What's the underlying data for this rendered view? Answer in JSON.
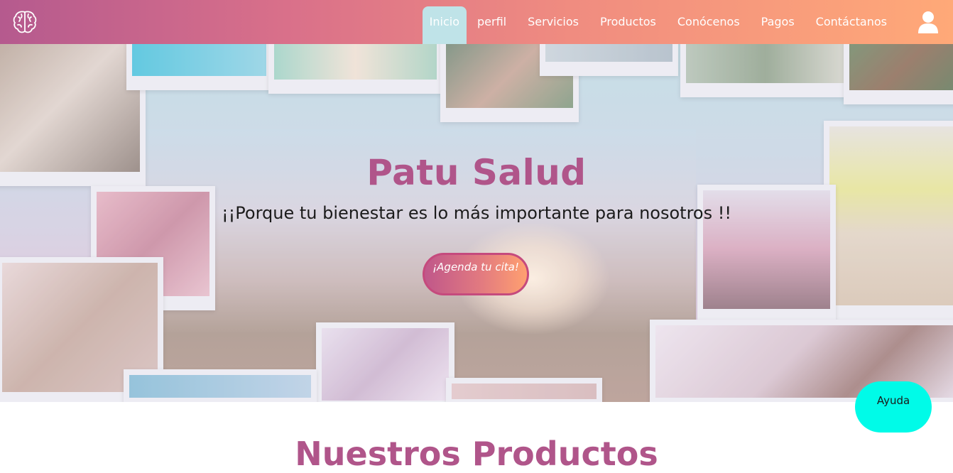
{
  "nav": {
    "items": [
      {
        "label": "Inicio",
        "active": true
      },
      {
        "label": "perfil"
      },
      {
        "label": "Servicios"
      },
      {
        "label": "Productos"
      },
      {
        "label": "Conócenos"
      },
      {
        "label": "Pagos"
      },
      {
        "label": "Contáctanos"
      }
    ],
    "logo_icon": "brain-icon",
    "user_icon": "user-icon"
  },
  "hero": {
    "title": "Patu Salud",
    "subtitle": "¡¡Porque tu bienestar es lo más importante para nosotros !!",
    "cta_label": "¡Agenda tu cita!"
  },
  "section": {
    "title": "Nuestros Productos"
  },
  "help": {
    "label": "Ayuda"
  },
  "colors": {
    "brand": "#b0558a",
    "nav_gradient_start": "#b55a8e",
    "nav_gradient_end": "#ffa978",
    "active_tab": "#bfe3e8",
    "help_button": "#00fbe8"
  }
}
